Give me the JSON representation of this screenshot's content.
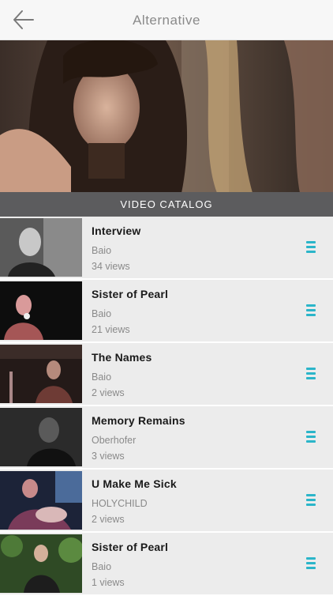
{
  "header": {
    "title": "Alternative",
    "back_icon": "arrow-left-icon"
  },
  "section_label": "VIDEO CATALOG",
  "accent_color": "#2bb5c9",
  "videos": [
    {
      "title": "Interview",
      "artist": "Baio",
      "views": "34 views"
    },
    {
      "title": "Sister of Pearl",
      "artist": "Baio",
      "views": "21 views"
    },
    {
      "title": "The Names",
      "artist": "Baio",
      "views": "2 views"
    },
    {
      "title": "Memory Remains",
      "artist": "Oberhofer",
      "views": "3 views"
    },
    {
      "title": "U Make Me Sick",
      "artist": "HOLYCHILD",
      "views": "2 views"
    },
    {
      "title": "Sister of Pearl",
      "artist": "Baio",
      "views": "1 views"
    }
  ]
}
